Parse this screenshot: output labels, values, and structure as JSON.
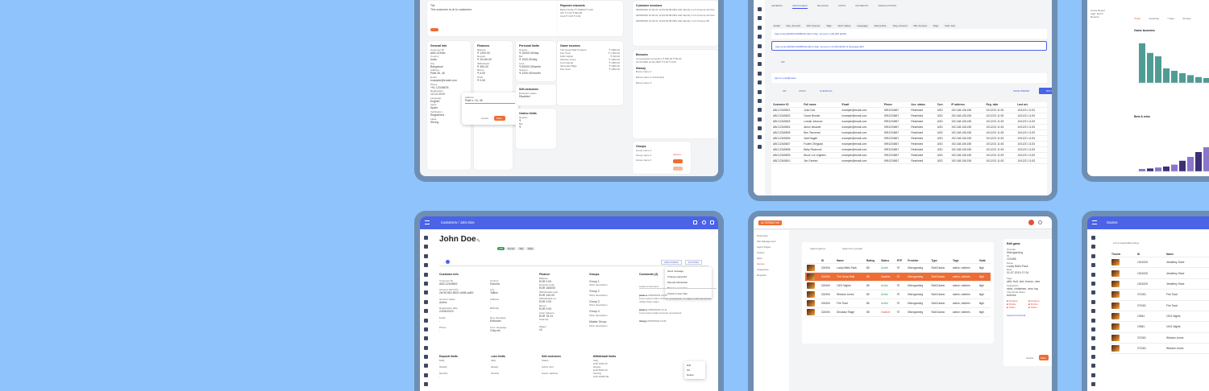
{
  "frameA": {
    "notes_head": [
      "Tile",
      "This customer is ok to customers"
    ],
    "general_info": {
      "title": "General info",
      "rows": [
        "Customer ID",
        "ABC12345x",
        "Country",
        "India",
        "City",
        "Bangalore",
        "Address",
        "Platt 26, 45",
        "Email",
        "example@email.com",
        "Phone",
        "+91 12345678",
        "Registration",
        "12-12-2019",
        "Language",
        "English",
        "Verify",
        "Spam",
        "Verification",
        "Registered",
        "Label",
        "Strong"
      ]
    },
    "finances": {
      "title": "Finances",
      "rows": [
        "Balance",
        "₹ 1200.00",
        "Deposit",
        "₹ 10146.00",
        "Withdrawal",
        "₹ 390.00",
        "Bonus",
        "₹ 0.00",
        "Profit",
        "₹ 0.00"
      ]
    },
    "popup": {
      "label": "Address",
      "value": "Platt n. 15, 45",
      "cancel": "Cancel",
      "save": "Save"
    },
    "personal_limits": {
      "title": "Personal limits",
      "rows": [
        "Deposit",
        "₹ 10000.00/day",
        "Bet",
        "₹ 1000.00/day",
        "Loss",
        "₹ 50000.00/week",
        "Session",
        "₹ 1200.00/month"
      ]
    },
    "self_exclusion": {
      "title": "Self-exclusion",
      "rows": [
        "Exclusion status",
        "Disabled"
      ]
    },
    "casino_limits": {
      "title": "Casino limits",
      "rows": [
        "Deposit",
        "₹",
        "Bet",
        "₹"
      ]
    },
    "payment_channels": {
      "title": "Payment channels",
      "rows": [
        [
          "Bank transfer",
          "₹ 250000",
          "₹ 0.00"
        ],
        [
          "UPI",
          "₹ 0.00",
          "₹ 820.00"
        ],
        [
          "Card",
          "₹ 0.00",
          "₹ 0.00"
        ]
      ]
    },
    "game_incomes": {
      "title": "Game incomes",
      "rows": [
        [
          "The Great Wall Treasure",
          "₹ 1800.00"
        ],
        [
          "Fire Toad",
          "₹ 1,500.00"
        ],
        [
          "1001 Nights",
          "₹ 190.00"
        ],
        [
          "Window Jones",
          "₹ 1800.00"
        ],
        [
          "Lust Islands",
          "₹ 1800.00"
        ],
        [
          "Shrouded Bags",
          "₹ 1800.00"
        ],
        [
          "Fire Toad",
          "₹ 1800.00"
        ]
      ]
    },
    "customer_sessions": {
      "title": "Customer sessions",
      "rows": [
        [
          "09/08/2020 10:00:21",
          "12:09:09:08-DB1:A02",
          "Identity 1.2.3 Cinema 10 Chrome 80"
        ],
        [
          "09/08/2020 10:00:21",
          "12:09:09:08-DB1:A02",
          "Identity 1.2.3 Cinema 10 Chrome 80"
        ],
        [
          "09/08/2020 10:00:21",
          "12:09:09:08-DB1:A02",
          "Identity 1.2.3 Chrome 80"
        ]
      ]
    },
    "bonuses": {
      "title": "Bonuses",
      "rows": [
        [
          "Long deposit conversion",
          "₹ 500.00",
          "₹ 50.00"
        ],
        [
          "01.02.2020",
          "21.02.2020",
          "₹ 0.00 ₹ 0.00"
        ]
      ]
    },
    "history": {
      "title": "History",
      "rows": [
        "Bonus name 1",
        "Bonus name 2 (Canceled)",
        "Bonus name 3"
      ]
    },
    "groups": {
      "title": "Groups",
      "rows": [
        "Group name 1",
        "Group name 2",
        "Group name 3"
      ],
      "action": "Actions"
    }
  },
  "frameB": {
    "tabs": [
      "GENERAL",
      "MULTI-FIELD",
      "BALANCE",
      "LIMITS",
      "PAYMENTS",
      "VERIFICATIONS"
    ],
    "filters": [
      "Email",
      "Dep. Amount",
      "Wd. Amount",
      "Tags",
      "Verif. status",
      "Language",
      "Self-exclus.",
      "Dep. Amount",
      "Wd. Amount",
      "Tags",
      "Verif. stat"
    ],
    "query1": "(Ignore Email/DEVC#AB#VALUE) & Dep. amount ≥ 100,000 (EUR)",
    "query2": "(Ignore Email/DEVC#AB#VALUE) & Dep. amount ≥ 10,000 (EUR) & language (EN)",
    "or_label": "OR",
    "query3": "Ignore email@value",
    "buttons": {
      "or": "OR",
      "undo": "UNDO",
      "clear": "CLEAR ALL",
      "save": "SAVE PRESET",
      "run": "RUN"
    },
    "columns": [
      "Customer ID",
      "Full name",
      "Email",
      "Phone",
      "Acc. status",
      "Curr.",
      "IP address",
      "Reg. date",
      "Last act."
    ],
    "rows": [
      [
        "ABC12345801",
        "John Doe",
        "example@email.com",
        "0991234567",
        "Restricted",
        "USD",
        "192.168.108.155",
        "10/12/21 11:53",
        "10/12/21 11:53"
      ],
      [
        "ABC12345802",
        "Cezar Brooke",
        "example@email.com",
        "0991234567",
        "Restricted",
        "USD",
        "192.168.108.155",
        "10/12/21 11:53",
        "10/12/21 11:53"
      ],
      [
        "ABC12345803",
        "Lorelai Johnson",
        "example@email.com",
        "0991234567",
        "Restricted",
        "USD",
        "192.168.108.155",
        "10/12/21 11:53",
        "10/12/21 11:53"
      ],
      [
        "ABC12345804",
        "Anton Ishaanil",
        "example@email.com",
        "0991234567",
        "Restricted",
        "USD",
        "192.168.108.155",
        "10/12/21 11:53",
        "10/12/21 11:53"
      ],
      [
        "ABC12345805",
        "Ben Tenmeral",
        "example@email.com",
        "0991234567",
        "Restricted",
        "USD",
        "192.168.108.155",
        "10/12/21 11:53",
        "10/12/21 11:53"
      ],
      [
        "ABC12345806",
        "Vadi Nagall",
        "example@email.com",
        "0991234567",
        "Restricted",
        "USD",
        "192.168.108.155",
        "10/12/21 11:53",
        "10/12/21 11:53"
      ],
      [
        "ABC12345807",
        "Fowler Zhegodd",
        "example@email.com",
        "0991234567",
        "Restricted",
        "USD",
        "192.168.108.155",
        "10/12/21 11:53",
        "10/12/21 11:53"
      ],
      [
        "ABC12345808",
        "Betty Ricamoni",
        "example@email.com",
        "0991234567",
        "Restricted",
        "USD",
        "192.168.108.155",
        "10/12/21 11:53",
        "10/12/21 11:53"
      ],
      [
        "ABC12345809",
        "Bruce Lui Lirighten",
        "example@email.com",
        "0991234567",
        "Restricted",
        "USD",
        "192.168.108.155",
        "10/12/21 11:53",
        "10/12/21 11:53"
      ],
      [
        "ABC12345810",
        "Jim Gertran",
        "example@email.com",
        "0991234567",
        "Restricted",
        "USD",
        "192.168.108.155",
        "10/12/21 11:53",
        "10/12/21 11:53"
      ]
    ]
  },
  "frameC": {
    "sidebar": [
      "Game Report",
      "Aggr. Event",
      "Reports"
    ],
    "tabs": [
      "Today",
      "Yesterday",
      "7 days",
      "30 days"
    ],
    "chart1_title": "Game launches",
    "chart2_title": "Bets & wins",
    "bars1": [
      0.82,
      0.62,
      0.55,
      0.3,
      0.25,
      0.2,
      0.16,
      0.12,
      0.1,
      0.08,
      0.07,
      0.06,
      0.05
    ],
    "bars2": [
      0.05,
      0.06,
      0.08,
      0.1,
      0.14,
      0.22,
      0.3,
      0.4,
      0.5,
      0.6,
      0.75,
      0.9
    ]
  },
  "frameD": {
    "breadcrumb": "Customers / John Doe",
    "name": "John Doe",
    "badges": [
      "VIP",
      "Group",
      "Tag",
      "Flag"
    ],
    "actions": [
      "ADD FUNDS",
      "ACTIONS"
    ],
    "menu": [
      "Send message",
      "Change password",
      "Manual withdrawal",
      "Balance correction",
      "Check in user help"
    ],
    "customer_info": {
      "title": "Customer info",
      "rows": [
        "Customer ID",
        "ABC12345801",
        "Country",
        "Estonia",
        "Account (SCA ID)",
        "2a7b1962-8820-4d08-ad00",
        "City",
        "Tallinn",
        "Account status",
        "Active",
        "Address",
        "-",
        "Registration date",
        "24/06/2023",
        "Birthday",
        "-",
        "Email",
        "-",
        "Reg. language",
        "Estonian",
        "Phone",
        "-",
        "Com. language",
        "Only etc"
      ]
    },
    "finance": {
      "title": "Finance",
      "rows": [
        "Balance",
        "EUR 0.00",
        "Deposits total",
        "EUR 165000",
        "Withdrawals total",
        "EUR 140.00",
        "Withdrawals tot.",
        "EUR 0.00",
        "Bonus",
        "EUR 0.00",
        "Avail. balance",
        "EUR 75.31",
        "Total bet",
        "-",
        "Wager",
        "x2"
      ]
    },
    "groups": {
      "title": "Groups",
      "items": [
        [
          "Group 1",
          "Short description"
        ],
        [
          "Group 2",
          "Short description"
        ],
        [
          "Group 3",
          "Short description"
        ],
        [
          "Group 4",
          "Short description"
        ],
        [
          "Master Group",
          "Short description"
        ]
      ]
    },
    "comments": {
      "title": "Comments (2)",
      "placeholder": "Leave a comment",
      "items": [
        [
          "jones.s",
          "25/06/2023 14:35",
          "Lorem ipsum dolor sit amet consectetur. In magna morbi fermentum nullam dolor quam."
        ],
        [
          "jones.s",
          "25/06/2023 14:11",
          "Lorem ipsum dolor sit amet consectetur."
        ],
        [
          "msoy.j",
          "25/06/2023 14:00",
          ""
        ]
      ],
      "ctx": [
        "Edit",
        "Pin",
        "Delete"
      ]
    },
    "bottom": [
      [
        "Deposit limits",
        "Daily",
        "-",
        "Weekly",
        "-",
        "Monthly",
        "-"
      ],
      [
        "Loss limits",
        "Daily",
        "-",
        "Weekly",
        "-",
        "Monthly",
        "-"
      ],
      [
        "Self-exclusion",
        "Status",
        "-",
        "Active until",
        "-",
        "Game machine",
        "-"
      ],
      [
        "Withdrawal limits",
        "Daily",
        "EUR 1000.00",
        "Weekly",
        "EUR 5000.00",
        "Monthly",
        "EUR 10000.00"
      ]
    ]
  },
  "frameE": {
    "logo": "ALTERNATIVE",
    "sidebar": [
      "Properties",
      "Slot Management",
      "Agent Pages",
      "Casino",
      "Slots",
      "Games",
      "Categories",
      "Deposits"
    ],
    "search_placeholder": "Search games",
    "filter_placeholder": "Search by provider",
    "columns": [
      "",
      "ID",
      "Name",
      "Rating",
      "Status",
      "RTP",
      "Provider",
      "Type",
      "Tags",
      "Volat."
    ],
    "rows": [
      [
        "324494",
        "Lucky Bells Pack",
        "85",
        "Active",
        "97",
        "Microgaming",
        "Slot/Casino",
        "action, witches",
        "high"
      ],
      [
        "324494",
        "The Great Wall",
        "85",
        "Inactive",
        "97",
        "Microgaming",
        "Slot/Casino",
        "action, witches",
        "high"
      ],
      [
        "324494",
        "1001 Nights",
        "85",
        "Active",
        "97",
        "Microgaming",
        "Slot/Casino",
        "action, witches",
        "high"
      ],
      [
        "324494",
        "Window Jones",
        "85",
        "Active",
        "97",
        "Microgaming",
        "Slot/Casino",
        "action, witches",
        "high"
      ],
      [
        "324494",
        "Fire Toad",
        "85",
        "Active",
        "97",
        "Microgaming",
        "Slot/Casino",
        "action, witches",
        "high"
      ],
      [
        "324494",
        "Dinosaur Rage",
        "85",
        "Inactive",
        "97",
        "Microgaming",
        "Slot/Casino",
        "action, witches",
        "high"
      ]
    ],
    "edit": {
      "title": "Edit game",
      "fields": [
        "Provider",
        "Microgaming",
        "ID",
        "123456",
        "Name",
        "Lucky Bells Pack",
        "Date",
        "31.07.2019 17:34"
      ],
      "subs": [
        "Tags",
        "wild, fruit, slot, bonus, new",
        "Categories",
        "slots, christmas, new, top",
        "Thumbnail status",
        "Actions"
      ],
      "statuses": [
        "Desktop",
        "Mobile",
        "Tablet"
      ],
      "statuses2": [
        "Desktop",
        "Mobile",
        "Tablet"
      ],
      "upload": "Upload thumbnail",
      "cancel": "Cancel",
      "save": "Save"
    }
  },
  "frameF": {
    "title": "Games",
    "subtitle": "List of searchable things",
    "columns": [
      "Thumb",
      "ID",
      "Name",
      "Status"
    ],
    "rows": [
      [
        "1001025",
        "Jewellery Store",
        "Unavailable"
      ],
      [
        "1001025",
        "Jewellery Store",
        "Available"
      ],
      [
        "1001025",
        "Jewellery Store",
        "Available"
      ],
      [
        "371061",
        "Fire Toad",
        "Available"
      ],
      [
        "371061",
        "Fire Toad",
        "Available"
      ],
      [
        "19381",
        "1001 Nights",
        "Available"
      ],
      [
        "19381",
        "1001 Nights",
        "Unavailable"
      ],
      [
        "371061",
        "Window Jones",
        "Available"
      ],
      [
        "371061",
        "Window Jones",
        "Available"
      ]
    ]
  }
}
